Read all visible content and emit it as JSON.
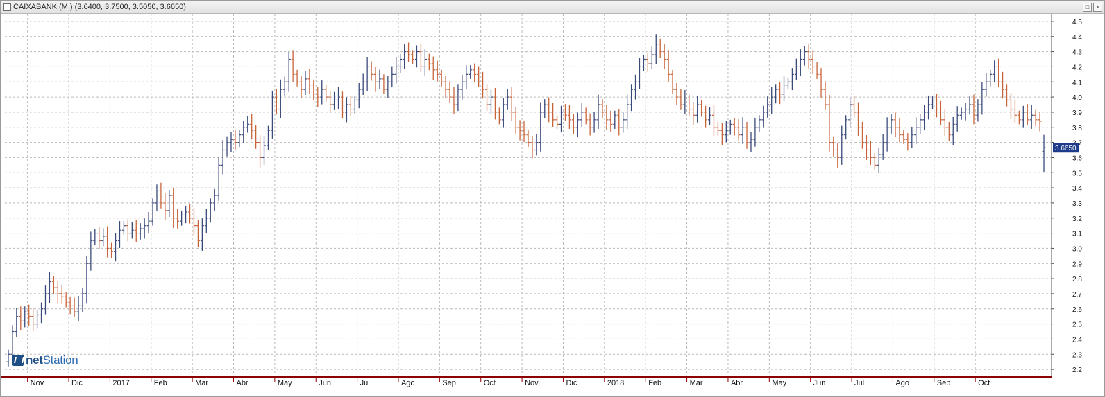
{
  "window": {
    "title": "CAIXABANK (M ) (3.6400, 3.7500, 3.5050, 3.6650)",
    "buttons": [
      "□",
      "×"
    ]
  },
  "logo": {
    "bold": "net",
    "regular": "Station"
  },
  "colors": {
    "up": "#3a4a7a",
    "down": "#c8643a",
    "grid": "#b9b9b9",
    "axis": "#8b0000",
    "last_bg": "#1e3a8a"
  },
  "chart_data": {
    "type": "ohlc-bar",
    "series_name": "CAIXABANK (M )",
    "last": {
      "open": 3.64,
      "high": 3.75,
      "low": 3.505,
      "close": 3.665,
      "label": "3.6650"
    },
    "ylim": [
      2.15,
      4.55
    ],
    "yticks": [
      2.2,
      2.3,
      2.4,
      2.5,
      2.6,
      2.7,
      2.8,
      2.9,
      3.0,
      3.1,
      3.2,
      3.3,
      3.4,
      3.5,
      3.6,
      3.7,
      3.8,
      3.9,
      4.0,
      4.1,
      4.2,
      4.3,
      4.4,
      4.5
    ],
    "ytick_labels": [
      "2.2",
      "2.3",
      "2.4",
      "2.5",
      "2.6",
      "2.7",
      "2.8",
      "2.9",
      "3.0",
      "3.1",
      "3.2",
      "3.3",
      "3.4",
      "3.5",
      "3.6",
      "3.7",
      "3.8",
      "3.9",
      "4.0",
      "4.1",
      "4.2",
      "4.3",
      "4.4",
      "4.5"
    ],
    "xticks": [
      "Nov",
      "Dic",
      "2017",
      "Feb",
      "Mar",
      "Abr",
      "May",
      "Jun",
      "Jul",
      "Ago",
      "Sep",
      "Oct",
      "Nov",
      "Dic",
      "2018",
      "Feb",
      "Mar",
      "Abr",
      "May",
      "Jun",
      "Jul",
      "Ago",
      "Sep",
      "Oct"
    ],
    "xtick_month_index": [
      1,
      2,
      3,
      4,
      5,
      6,
      7,
      8,
      9,
      10,
      11,
      12,
      13,
      14,
      15,
      16,
      17,
      18,
      19,
      20,
      21,
      22,
      23,
      24
    ],
    "grid": true,
    "closes": [
      2.3,
      2.45,
      2.55,
      2.52,
      2.58,
      2.55,
      2.5,
      2.56,
      2.6,
      2.7,
      2.78,
      2.74,
      2.7,
      2.68,
      2.64,
      2.62,
      2.58,
      2.62,
      2.7,
      2.9,
      3.05,
      3.1,
      3.05,
      3.08,
      3.0,
      2.98,
      3.05,
      3.12,
      3.15,
      3.1,
      3.12,
      3.1,
      3.13,
      3.15,
      3.18,
      3.3,
      3.38,
      3.3,
      3.25,
      3.35,
      3.2,
      3.18,
      3.22,
      3.24,
      3.2,
      3.15,
      3.05,
      3.15,
      3.2,
      3.3,
      3.35,
      3.55,
      3.65,
      3.7,
      3.72,
      3.7,
      3.75,
      3.8,
      3.82,
      3.78,
      3.7,
      3.6,
      3.68,
      3.78,
      4.0,
      3.92,
      4.05,
      4.1,
      4.25,
      4.15,
      4.1,
      4.05,
      4.12,
      4.08,
      4.02,
      4.0,
      4.05,
      4.0,
      3.95,
      3.98,
      4.0,
      3.9,
      3.95,
      3.92,
      3.98,
      4.05,
      4.1,
      4.2,
      4.15,
      4.1,
      4.12,
      4.05,
      4.1,
      4.15,
      4.2,
      4.25,
      4.3,
      4.28,
      4.25,
      4.3,
      4.2,
      4.25,
      4.22,
      4.18,
      4.15,
      4.1,
      4.05,
      4.0,
      3.95,
      4.05,
      4.1,
      4.15,
      4.18,
      4.15,
      4.1,
      4.05,
      3.95,
      4.0,
      3.9,
      3.85,
      3.95,
      4.0,
      3.9,
      3.8,
      3.78,
      3.75,
      3.7,
      3.65,
      3.7,
      3.9,
      3.95,
      3.9,
      3.85,
      3.82,
      3.9,
      3.88,
      3.85,
      3.8,
      3.85,
      3.9,
      3.85,
      3.8,
      3.85,
      3.95,
      3.9,
      3.85,
      3.82,
      3.88,
      3.8,
      3.85,
      3.95,
      4.05,
      4.1,
      4.2,
      4.25,
      4.22,
      4.28,
      4.35,
      4.3,
      4.25,
      4.15,
      4.05,
      4.0,
      3.95,
      3.98,
      3.92,
      3.88,
      3.95,
      3.9,
      3.85,
      3.88,
      3.8,
      3.78,
      3.75,
      3.78,
      3.82,
      3.8,
      3.75,
      3.8,
      3.7,
      3.72,
      3.8,
      3.85,
      3.9,
      3.95,
      4.0,
      4.05,
      4.02,
      4.08,
      4.1,
      4.15,
      4.2,
      4.25,
      4.3,
      4.25,
      4.2,
      4.15,
      4.05,
      3.95,
      3.7,
      3.65,
      3.6,
      3.75,
      3.85,
      3.95,
      3.9,
      3.8,
      3.7,
      3.65,
      3.6,
      3.55,
      3.62,
      3.7,
      3.8,
      3.85,
      3.8,
      3.75,
      3.72,
      3.7,
      3.75,
      3.8,
      3.85,
      3.9,
      3.95,
      3.98,
      3.92,
      3.85,
      3.8,
      3.75,
      3.82,
      3.88,
      3.9,
      3.92,
      3.95,
      3.88,
      3.95,
      4.05,
      4.1,
      4.15,
      4.2,
      4.1,
      4.05,
      3.98,
      3.92,
      3.88,
      3.85,
      3.9,
      3.85,
      3.88,
      3.85,
      3.84,
      3.66
    ]
  }
}
